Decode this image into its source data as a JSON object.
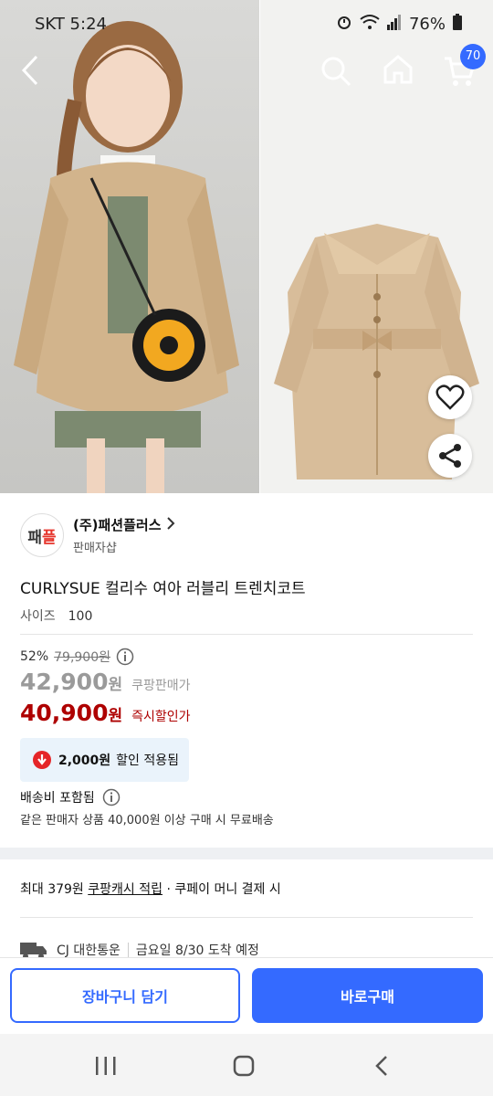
{
  "status_bar": {
    "carrier_time": "SKT 5:24",
    "battery": "76%"
  },
  "header": {
    "cart_count": "70"
  },
  "seller": {
    "logo_char1": "패",
    "logo_char2": "플",
    "name": "(주)패션플러스",
    "sub": "판매자샵"
  },
  "product": {
    "title": "CURLYSUE 컬리수 여아 러블리 트렌치코트"
  },
  "option": {
    "label": "사이즈",
    "value": "100"
  },
  "pricing": {
    "discount_rate": "52%",
    "original_price": "79,900원",
    "coupang_price_amount": "42,900",
    "coupang_price_unit": "원",
    "coupang_price_label": "쿠팡판매가",
    "instant_price_amount": "40,900",
    "instant_price_unit": "원",
    "instant_price_label": "즉시할인가"
  },
  "coupon": {
    "amount": "2,000원",
    "text": "할인 적용됨"
  },
  "shipping": {
    "included": "배송비 포함됨",
    "free_condition": "같은 판매자 상품 40,000원 이상 구매 시 무료배송"
  },
  "cash": {
    "prefix": "최대 379원",
    "link": "쿠팡캐시 적립",
    "suffix": " · 쿠페이 머니 결제 시"
  },
  "delivery": {
    "carrier": "CJ 대한통운",
    "eta": "금요일 8/30 도착 예정"
  },
  "actions": {
    "cart_label": "장바구니 담기",
    "buy_label": "바로구매"
  },
  "colors": {
    "accent": "#346aff",
    "price_red": "#ae0000"
  }
}
